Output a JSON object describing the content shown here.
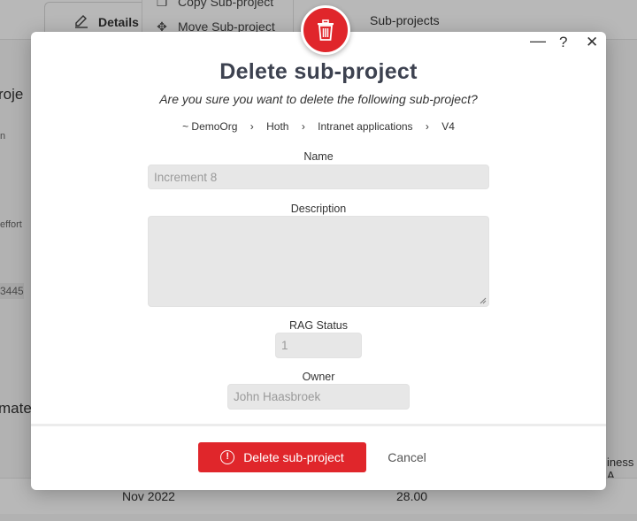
{
  "background": {
    "details_tab": "Details",
    "menu_copy": "Copy Sub-project",
    "menu_move": "Move Sub-project",
    "subprojects_tab": "Sub-projects",
    "left_heading": "roje",
    "left_n": "n",
    "left_effort": "effort",
    "left_number": "3445",
    "left_mated": "mate",
    "right_cut": "iness A",
    "row_date": "Nov 2022",
    "row_value": "28.00"
  },
  "modal": {
    "minimize": "—",
    "help": "?",
    "close": "✕",
    "title": "Delete sub-project",
    "question": "Are you sure you want to delete the following sub-project?",
    "breadcrumb": [
      "~ DemoOrg",
      "Hoth",
      "Intranet applications",
      "V4"
    ],
    "breadcrumb_sep": "›",
    "fields": {
      "name_label": "Name",
      "name_value": "Increment 8",
      "description_label": "Description",
      "description_value": "",
      "rag_label": "RAG Status",
      "rag_value": "1",
      "owner_label": "Owner",
      "owner_value": "John Haasbroek"
    },
    "delete_button": "Delete sub-project",
    "cancel_button": "Cancel"
  },
  "colors": {
    "accent_red": "#e0262b",
    "title": "#3d4250"
  }
}
